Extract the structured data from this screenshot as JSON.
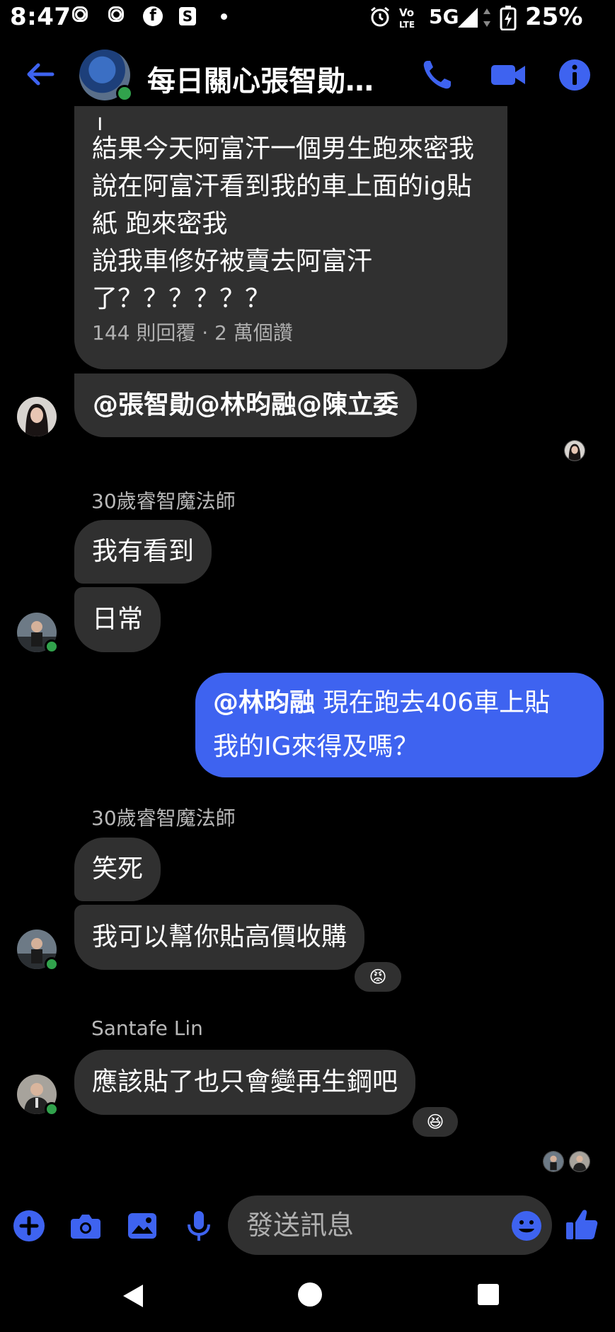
{
  "status_bar": {
    "time": "8:47",
    "network": "5G",
    "battery": "25%",
    "icons": [
      "instagram-icon",
      "instagram-icon",
      "facebook-icon",
      "shop-icon",
      "dot-icon",
      "alarm-icon",
      "volte-icon",
      "signal-icon",
      "battery-charging-icon"
    ]
  },
  "header": {
    "title": "每日關心張智勛…",
    "accent": "#3e63f0"
  },
  "messages": {
    "m1": {
      "lines": [
        "」",
        "結果今天阿富汗一個男生跑來密我",
        "說在阿富汗看到我的車上面的ig貼",
        "紙 跑來密我",
        "說我車修好被賣去阿富汗",
        "了？？？？？？"
      ],
      "meta": "144 則回覆 · 2 萬個讚"
    },
    "m2": {
      "text": "@張智勛@林昀融@陳立委"
    },
    "g2": {
      "sender": "30歲睿智魔法師",
      "m3": "我有看到",
      "m4": "日常"
    },
    "me": {
      "mention": "@林昀融",
      "line1": " 現在跑去406車上貼",
      "line2": "我的IG來得及嗎？"
    },
    "g3": {
      "sender": "30歲睿智魔法師",
      "m5": "笑死",
      "m6": "我可以幫你貼高價收購",
      "reaction": "😡"
    },
    "g4": {
      "sender": "Santafe Lin",
      "m7": "應該貼了也只會變再生鋼吧",
      "reaction": "😆"
    }
  },
  "composer": {
    "placeholder": "發送訊息"
  }
}
